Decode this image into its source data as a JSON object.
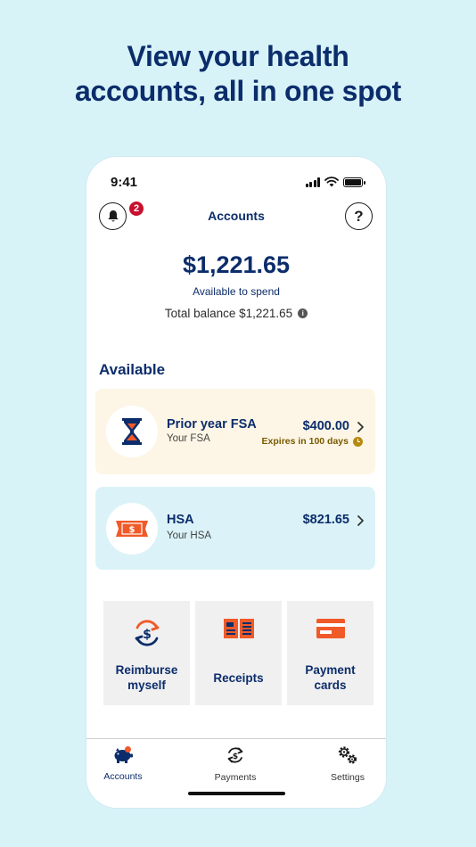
{
  "headline": {
    "line1": "View your health",
    "line2": "accounts, all in one spot"
  },
  "status_bar": {
    "time": "9:41"
  },
  "header": {
    "title": "Accounts",
    "notification_count": "2",
    "help_label": "?"
  },
  "balance": {
    "amount": "$1,221.65",
    "label": "Available to spend",
    "total": "Total balance $1,221.65",
    "info_label": "i"
  },
  "available": {
    "title": "Available",
    "accounts": [
      {
        "name": "Prior year FSA",
        "subtitle": "Your FSA",
        "amount": "$400.00",
        "note": "Expires in 100 days",
        "icon": "hourglass-icon",
        "background": "#fdf6e6"
      },
      {
        "name": "HSA",
        "subtitle": "Your HSA",
        "amount": "$821.65",
        "icon": "dollar-bill-icon",
        "background": "#dbf3f8"
      }
    ]
  },
  "quick_actions": [
    {
      "label": "Reimburse myself",
      "icon": "reimburse-icon"
    },
    {
      "label": "Receipts",
      "icon": "receipt-book-icon"
    },
    {
      "label": "Payment cards",
      "icon": "payment-card-icon"
    }
  ],
  "tabbar": {
    "tabs": [
      {
        "label": "Accounts",
        "icon": "piggy-bank-icon",
        "active": true
      },
      {
        "label": "Payments",
        "icon": "payments-icon",
        "active": false
      },
      {
        "label": "Settings",
        "icon": "gears-icon",
        "active": false
      }
    ]
  },
  "colors": {
    "page_background": "#d8f3f8",
    "navy": "#0c2d6b",
    "accent_orange": "#f05a28",
    "badge_red": "#c8102e",
    "expires_gold": "#7a5a00"
  }
}
